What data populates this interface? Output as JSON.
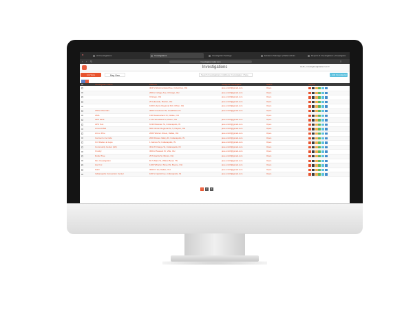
{
  "browser": {
    "tabs": [
      {
        "title": "All Investigations",
        "active": false
      },
      {
        "title": "Investigations",
        "active": true
      },
      {
        "title": "Investigation Settings",
        "active": false
      },
      {
        "title": "Evidence Manager | Radar Admin",
        "active": false
      },
      {
        "title": "Reports & Investigations | Investigator",
        "active": false
      }
    ],
    "url": "investigator.radar.com"
  },
  "app": {
    "title": "Investigations",
    "user_text": "Hello, investigator@radar.com ▾"
  },
  "toolbar": {
    "list_label": "List View",
    "map_label": "Map View",
    "search_placeholder": "Search Investigations | Address | Investigator | Type",
    "add_label": "+ Add Investigation"
  },
  "table": {
    "columns": [
      "Investigation Name",
      "Address",
      "Assigned Investigator",
      "Status",
      "Actions"
    ],
    "rows": [
      {
        "name": "",
        "address": "404 S Westmoreland Ave, Columbus, OH",
        "email": "jane.smith@gmail.com",
        "status": "Open"
      },
      {
        "name": "",
        "address": "200 E College Ave, Chicago, OH",
        "email": "jane.smith@gmail.com",
        "status": "Open"
      },
      {
        "name": "",
        "address": "Chicago, OH",
        "email": "jane.smith@gmail.com",
        "status": "Open"
      },
      {
        "name": "",
        "address": "25 Lakeside, Boston, OH",
        "email": "jane.smith@gmail.com",
        "status": "Open"
      },
      {
        "name": "",
        "address": "1000 Liberty Regional Rd, Clifton, OH",
        "email": "jane.smith@gmail.com",
        "status": "Open"
      },
      {
        "name": "Abbie Mountain",
        "address": "3000 Crestwood St, Heathfield, IN",
        "email": "jane.smith@gmail.com",
        "status": "Open"
      },
      {
        "name": "AMA",
        "address": "190 Meadowland Dr, Dallas, OH",
        "email": "",
        "status": "Open"
      },
      {
        "name": "APP DP/3",
        "address": "1722 Woodland St, Plano, OH",
        "email": "jane.smith@gmail.com",
        "status": "Open"
      },
      {
        "name": "APS Test",
        "address": "6130 Marsden St, Indianapolis, IN",
        "email": "jane.smith@gmail.com",
        "status": "Open"
      },
      {
        "name": "Art and Mall",
        "address": "500 Clinton Regional St, 5, Dayton, OH",
        "email": "jane.smith@gmail.com",
        "status": "Open"
      },
      {
        "name": "Art on Pine",
        "address": "2000 Warren Street, Dallas, OH",
        "email": "jane.smith@gmail.com",
        "status": "Open"
      },
      {
        "name": "Carmen's Ice Cafe",
        "address": "200 Rhodes Valley Dr, Indianapolis, IN",
        "email": "jane.smith@gmail.com",
        "status": "Open"
      },
      {
        "name": "Cin Shelter at Lupe",
        "address": "1 Jaimes St, Indianapolis, IN",
        "email": "jane.smith@gmail.com",
        "status": "Open"
      },
      {
        "name": "Community Center (Hh)",
        "address": "301 W Orange St, Indianapolis, IN",
        "email": "jane.smith@gmail.com",
        "status": "Open"
      },
      {
        "name": "Crosby",
        "address": "300 E Pleasant St, Ville, OH",
        "email": "jane.smith@gmail.com",
        "status": "Open"
      },
      {
        "name": "Dollar Tree",
        "address": "25 N Harris St, Illinois, OH",
        "email": "jane.smith@gmail.com",
        "status": "Open"
      },
      {
        "name": "Fire Investigation",
        "address": "81 S Main St, Willow Bend, TN",
        "email": "jane.smith@gmail.com",
        "status": "Open"
      },
      {
        "name": "Hair Inc",
        "address": "1200 Wharton Street St, Boone, OH",
        "email": "jane.smith@gmail.com",
        "status": "Open"
      },
      {
        "name": "Kahn",
        "address": "3000 N 1st, Dallas, OH",
        "email": "jane.smith@gmail.com",
        "status": "Open"
      },
      {
        "name": "Indianapolis Convention Center",
        "address": "100 S Capitol Ave, Indianapolis, IN",
        "email": "jane.smith@gmail.com",
        "status": "Open"
      }
    ]
  },
  "actions": {
    "icons": [
      "view-icon",
      "map-icon",
      "note-icon",
      "photo-icon",
      "edit-icon",
      "share-icon"
    ],
    "colors": [
      "#e8542f",
      "#3b3b3b",
      "#f0ad4e",
      "#5cb85c",
      "#5bc0de",
      "#428bca"
    ]
  },
  "pagination": {
    "pages": [
      "1",
      "2",
      "3"
    ],
    "active_color": "#e8542f",
    "inactive_color": "#555555"
  },
  "colors": {
    "accent": "#e8542f",
    "info": "#5bc0de"
  }
}
